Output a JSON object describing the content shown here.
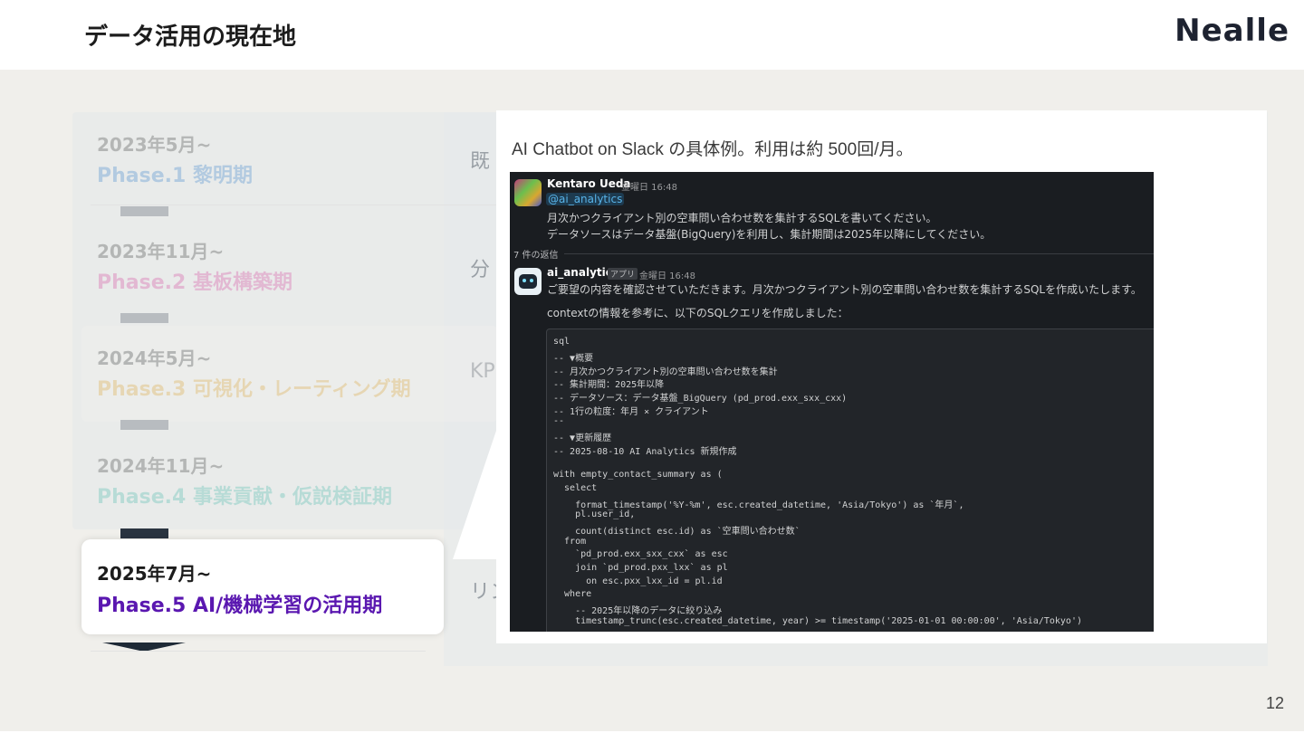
{
  "header": {
    "title": "データ活用の現在地",
    "brand": "Nealle"
  },
  "phases": [
    {
      "date": "2023年5月~",
      "name": "Phase.1 黎明期",
      "color": "#4f8fd0"
    },
    {
      "date": "2023年11月~",
      "name": "Phase.2 基板構築期",
      "color": "#d65ba8"
    },
    {
      "date": "2024年5月~",
      "name": "Phase.3 可視化・レーティング期",
      "color": "#e3b14f"
    },
    {
      "date": "2024年11月~",
      "name": "Phase.4 事業貢献・仮説検証期",
      "color": "#5cc0b3"
    },
    {
      "date": "2025年7月~",
      "name": "Phase.5 AI/機械学習の活用期",
      "color": "#5a17b0"
    }
  ],
  "side_labels": [
    "既",
    "分",
    "KP",
    "リン"
  ],
  "card": {
    "caption": "AI Chatbot on Slack の具体例。利用は約 500回/月。"
  },
  "slack": {
    "user_message": {
      "author": "Kentaro Ueda",
      "time": "金曜日 16:48",
      "mention": "@ai_analytics",
      "lines": [
        "月次かつクライアント別の空車問い合わせ数を集計するSQLを書いてください。",
        "データソースはデータ基盤(BigQuery)を利用し、集計期間は2025年以降にしてください。"
      ]
    },
    "reply_count": "7 件の返信",
    "bot_message": {
      "author": "ai_analytics",
      "badge": "アプリ",
      "time": "金曜日 16:48",
      "lines": [
        "ご要望の内容を確認させていただきます。月次かつクライアント別の空車問い合わせ数を集計するSQLを作成いたします。",
        "contextの情報を参考に、以下のSQLクエリを作成しました："
      ]
    },
    "code": [
      "sql",
      "-- ▼概要",
      "-- 月次かつクライアント別の空車問い合わせ数を集計",
      "-- 集計期間：2025年以降",
      "-- データソース：データ基盤_BigQuery (pd_prod.exx_sxx_cxx)",
      "-- 1行の粒度：年月 × クライアント",
      "--",
      "-- ▼更新履歴",
      "-- 2025-08-10 AI Analytics 新規作成",
      "",
      "with empty_contact_summary as (",
      "  select",
      "    format_timestamp('%Y-%m', esc.created_datetime, 'Asia/Tokyo') as `年月`,",
      "    pl.user_id,",
      "    count(distinct esc.id) as `空車問い合わせ数`",
      "  from",
      "    `pd_prod.exx_sxx_cxx` as esc",
      "    join `pd_prod.pxx_lxx` as pl",
      "      on esc.pxx_lxx_id = pl.id",
      "  where",
      "    -- 2025年以降のデータに絞り込み",
      "    timestamp_trunc(esc.created_datetime, year) >= timestamp('2025-01-01 00:00:00', 'Asia/Tokyo')"
    ]
  },
  "page_number": "12"
}
